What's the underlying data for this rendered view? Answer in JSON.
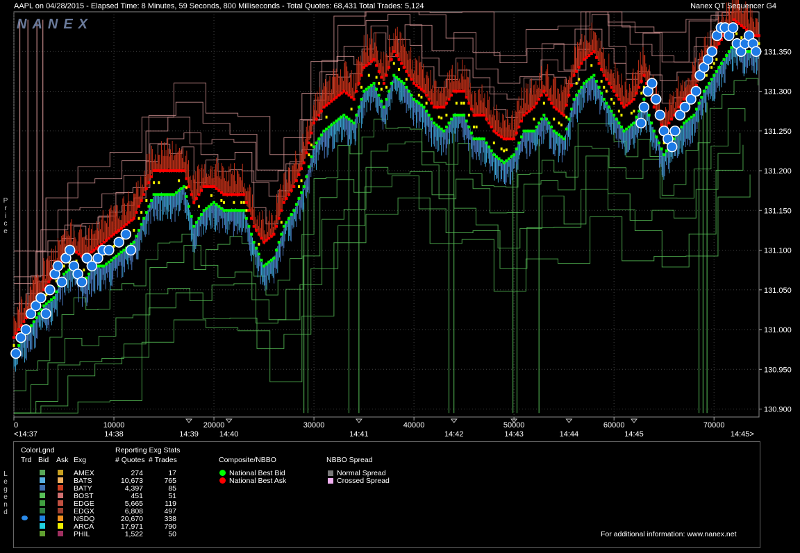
{
  "header": {
    "left": "AAPL on 04/28/2015  -  Elapsed Time: 8 Minutes, 59 Seconds, 800 Milliseconds  -  Total Quotes: 68,431  Total Trades: 5,124",
    "right": "Nanex QT Sequencer G4",
    "watermark": "NANEX"
  },
  "colors": {
    "bg": "#000000",
    "grid": "#555555",
    "bid": "#00ff00",
    "ask": "#ff0000",
    "trade": "#1e7be6",
    "pink": "#e6a0a0",
    "green": "#59c459"
  },
  "chart_data": {
    "type": "line",
    "xlim": [
      0,
      74500
    ],
    "ylim": [
      130.89,
      131.4
    ],
    "ylabel": "Price",
    "x_ticks": [
      {
        "v": 0,
        "label": "0"
      },
      {
        "v": 10000,
        "label": "10000"
      },
      {
        "v": 20000,
        "label": "20000"
      },
      {
        "v": 30000,
        "label": "30000"
      },
      {
        "v": 40000,
        "label": "40000"
      },
      {
        "v": 50000,
        "label": "50000"
      },
      {
        "v": 60000,
        "label": "60000"
      },
      {
        "v": 70000,
        "label": "70000"
      }
    ],
    "time_ticks": [
      {
        "v": 0,
        "label": "<14:37"
      },
      {
        "v": 10000,
        "label": "14:38"
      },
      {
        "v": 17500,
        "label": "14:39"
      },
      {
        "v": 21500,
        "label": "14:40"
      },
      {
        "v": 34500,
        "label": "14:41"
      },
      {
        "v": 44000,
        "label": "14:42"
      },
      {
        "v": 50000,
        "label": "14:43"
      },
      {
        "v": 55500,
        "label": "14:44"
      },
      {
        "v": 62000,
        "label": "14:45"
      },
      {
        "v": 74000,
        "label": "14:45>"
      }
    ],
    "y_ticks": [
      {
        "v": 130.9,
        "label": "130.900"
      },
      {
        "v": 130.95,
        "label": "130.950"
      },
      {
        "v": 131.0,
        "label": "131.000"
      },
      {
        "v": 131.05,
        "label": "131.050"
      },
      {
        "v": 131.1,
        "label": "131.100"
      },
      {
        "v": 131.15,
        "label": "131.150"
      },
      {
        "v": 131.2,
        "label": "131.200"
      },
      {
        "v": 131.25,
        "label": "131.250"
      },
      {
        "v": 131.3,
        "label": "131.300"
      },
      {
        "v": 131.35,
        "label": "131.350"
      }
    ],
    "triangle_markers": [
      17500,
      21500,
      34500,
      44000,
      50000,
      55500,
      62000
    ],
    "series": [
      {
        "name": "National Best Bid",
        "x": [
          0,
          1000,
          2000,
          3000,
          4000,
          5000,
          6000,
          7000,
          8000,
          9000,
          10000,
          11000,
          12000,
          13000,
          14000,
          15000,
          16000,
          17000,
          18000,
          19000,
          20000,
          21000,
          22000,
          23000,
          24000,
          25000,
          26000,
          27000,
          28000,
          29000,
          30000,
          31000,
          32000,
          33000,
          34000,
          35000,
          36000,
          37000,
          38000,
          39000,
          40000,
          41000,
          42000,
          43000,
          44000,
          45000,
          46000,
          47000,
          48000,
          49000,
          50000,
          51000,
          52000,
          53000,
          54000,
          55000,
          56000,
          57000,
          58000,
          59000,
          60000,
          61000,
          62000,
          63000,
          64000,
          65000,
          66000,
          67000,
          68000,
          69000,
          70000,
          71000,
          72000,
          73000,
          74000
        ],
        "values": [
          130.97,
          130.99,
          131.01,
          131.03,
          131.04,
          131.07,
          131.08,
          131.06,
          131.08,
          131.08,
          131.09,
          131.1,
          131.11,
          131.14,
          131.17,
          131.17,
          131.17,
          131.18,
          131.13,
          131.15,
          131.16,
          131.15,
          131.15,
          131.15,
          131.11,
          131.08,
          131.09,
          131.13,
          131.15,
          131.18,
          131.23,
          131.25,
          131.26,
          131.27,
          131.26,
          131.3,
          131.31,
          131.28,
          131.32,
          131.31,
          131.29,
          131.28,
          131.26,
          131.25,
          131.27,
          131.27,
          131.24,
          131.24,
          131.22,
          131.21,
          131.22,
          131.25,
          131.25,
          131.27,
          131.25,
          131.24,
          131.29,
          131.31,
          131.32,
          131.29,
          131.27,
          131.25,
          131.26,
          131.29,
          131.25,
          131.22,
          131.24,
          131.26,
          131.27,
          131.3,
          131.32,
          131.34,
          131.36,
          131.35,
          131.35
        ]
      },
      {
        "name": "National Best Ask",
        "x": [
          0,
          1000,
          2000,
          3000,
          4000,
          5000,
          6000,
          7000,
          8000,
          9000,
          10000,
          11000,
          12000,
          13000,
          14000,
          15000,
          16000,
          17000,
          18000,
          19000,
          20000,
          21000,
          22000,
          23000,
          24000,
          25000,
          26000,
          27000,
          28000,
          29000,
          30000,
          31000,
          32000,
          33000,
          34000,
          35000,
          36000,
          37000,
          38000,
          39000,
          40000,
          41000,
          42000,
          43000,
          44000,
          45000,
          46000,
          47000,
          48000,
          49000,
          50000,
          51000,
          52000,
          53000,
          54000,
          55000,
          56000,
          57000,
          58000,
          59000,
          60000,
          61000,
          62000,
          63000,
          64000,
          65000,
          66000,
          67000,
          68000,
          69000,
          70000,
          71000,
          72000,
          73000,
          74000
        ],
        "values": [
          130.99,
          131.01,
          131.03,
          131.05,
          131.07,
          131.09,
          131.1,
          131.09,
          131.1,
          131.11,
          131.12,
          131.13,
          131.14,
          131.17,
          131.2,
          131.2,
          131.2,
          131.2,
          131.16,
          131.18,
          131.18,
          131.17,
          131.17,
          131.17,
          131.13,
          131.11,
          131.12,
          131.16,
          131.18,
          131.21,
          131.26,
          131.28,
          131.29,
          131.3,
          131.29,
          131.33,
          131.34,
          131.31,
          131.35,
          131.33,
          131.31,
          131.3,
          131.28,
          131.28,
          131.3,
          131.3,
          131.27,
          131.27,
          131.25,
          131.24,
          131.24,
          131.27,
          131.28,
          131.3,
          131.28,
          131.27,
          131.32,
          131.34,
          131.35,
          131.32,
          131.3,
          131.28,
          131.29,
          131.32,
          131.28,
          131.25,
          131.27,
          131.29,
          131.3,
          131.33,
          131.35,
          131.37,
          131.39,
          131.38,
          131.37
        ]
      }
    ],
    "trades": [
      {
        "x": 200,
        "y": 130.97
      },
      {
        "x": 700,
        "y": 130.99
      },
      {
        "x": 1200,
        "y": 131.0
      },
      {
        "x": 1700,
        "y": 131.02
      },
      {
        "x": 2200,
        "y": 131.03
      },
      {
        "x": 2700,
        "y": 131.04
      },
      {
        "x": 3200,
        "y": 131.02
      },
      {
        "x": 3600,
        "y": 131.05
      },
      {
        "x": 4100,
        "y": 131.07
      },
      {
        "x": 4400,
        "y": 131.08
      },
      {
        "x": 4800,
        "y": 131.06
      },
      {
        "x": 5200,
        "y": 131.09
      },
      {
        "x": 5600,
        "y": 131.1
      },
      {
        "x": 6000,
        "y": 131.08
      },
      {
        "x": 6400,
        "y": 131.07
      },
      {
        "x": 6800,
        "y": 131.06
      },
      {
        "x": 7300,
        "y": 131.09
      },
      {
        "x": 7800,
        "y": 131.08
      },
      {
        "x": 8400,
        "y": 131.09
      },
      {
        "x": 8900,
        "y": 131.1
      },
      {
        "x": 9500,
        "y": 131.1
      },
      {
        "x": 10500,
        "y": 131.11
      },
      {
        "x": 11200,
        "y": 131.12
      },
      {
        "x": 11700,
        "y": 131.1
      },
      {
        "x": 62700,
        "y": 131.26
      },
      {
        "x": 63000,
        "y": 131.28
      },
      {
        "x": 63400,
        "y": 131.3
      },
      {
        "x": 63800,
        "y": 131.31
      },
      {
        "x": 64200,
        "y": 131.29
      },
      {
        "x": 64600,
        "y": 131.27
      },
      {
        "x": 65000,
        "y": 131.25
      },
      {
        "x": 65400,
        "y": 131.24
      },
      {
        "x": 65800,
        "y": 131.23
      },
      {
        "x": 66100,
        "y": 131.25
      },
      {
        "x": 66600,
        "y": 131.27
      },
      {
        "x": 67100,
        "y": 131.28
      },
      {
        "x": 67700,
        "y": 131.29
      },
      {
        "x": 68200,
        "y": 131.3
      },
      {
        "x": 68600,
        "y": 131.32
      },
      {
        "x": 69000,
        "y": 131.33
      },
      {
        "x": 69400,
        "y": 131.34
      },
      {
        "x": 69800,
        "y": 131.35
      },
      {
        "x": 70300,
        "y": 131.37
      },
      {
        "x": 70700,
        "y": 131.38
      },
      {
        "x": 71100,
        "y": 131.38
      },
      {
        "x": 71500,
        "y": 131.37
      },
      {
        "x": 71900,
        "y": 131.38
      },
      {
        "x": 72300,
        "y": 131.36
      },
      {
        "x": 72700,
        "y": 131.35
      },
      {
        "x": 73100,
        "y": 131.36
      },
      {
        "x": 73500,
        "y": 131.37
      },
      {
        "x": 73900,
        "y": 131.36
      },
      {
        "x": 74200,
        "y": 131.35
      }
    ]
  },
  "legend": {
    "vert_label": "Legend",
    "color_legend": "ColorLgnd",
    "stats_title": "Reporting Exg Stats",
    "col_trd": "Trd",
    "col_bid": "Bid",
    "col_ask": "Ask",
    "col_exg": "Exg",
    "col_quotes": "# Quotes",
    "col_trades": "# Trades",
    "rows": [
      {
        "exg": "AMEX",
        "quotes": "274",
        "trades": "17",
        "bid_color": "#58a858",
        "ask_color": "#c8a020",
        "trd": false
      },
      {
        "exg": "BATS",
        "quotes": "10,673",
        "trades": "765",
        "bid_color": "#58b0e0",
        "ask_color": "#f0b060",
        "trd": false
      },
      {
        "exg": "BATY",
        "quotes": "4,397",
        "trades": "85",
        "bid_color": "#4070b0",
        "ask_color": "#d04020",
        "trd": false
      },
      {
        "exg": "BOST",
        "quotes": "451",
        "trades": "51",
        "bid_color": "#58c058",
        "ask_color": "#d07070",
        "trd": false
      },
      {
        "exg": "EDGE",
        "quotes": "5,665",
        "trades": "119",
        "bid_color": "#40a040",
        "ask_color": "#c05040",
        "trd": false
      },
      {
        "exg": "EDGX",
        "quotes": "6,808",
        "trades": "497",
        "bid_color": "#308040",
        "ask_color": "#a04030",
        "trd": false
      },
      {
        "exg": "NSDQ",
        "quotes": "20,670",
        "trades": "338",
        "bid_color": "#2080e0",
        "ask_color": "#f09020",
        "trd": true
      },
      {
        "exg": "ARCA",
        "quotes": "17,971",
        "trades": "790",
        "bid_color": "#20d0e0",
        "ask_color": "#f0f000",
        "trd": false
      },
      {
        "exg": "PHIL",
        "quotes": "1,522",
        "trades": "50",
        "bid_color": "#60a030",
        "ask_color": "#a03060",
        "trd": false
      }
    ],
    "composite_title": "Composite/NBBO",
    "nbb_label": "National Best Bid",
    "nbo_label": "National Best Ask",
    "spread_title": "NBBO Spread",
    "normal_spread": "Normal Spread",
    "crossed_spread": "Crossed Spread",
    "footer": "For additional information: www.nanex.net"
  }
}
